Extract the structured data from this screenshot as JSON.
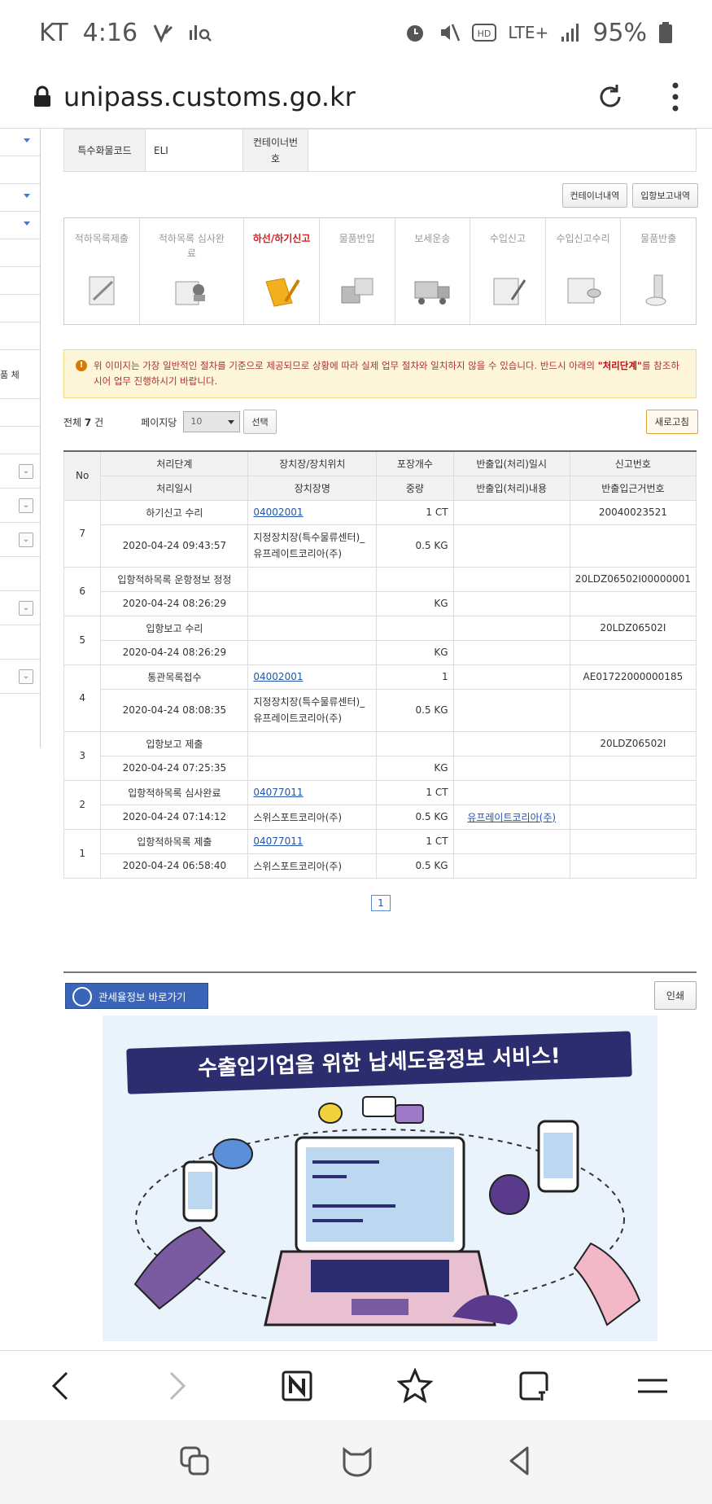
{
  "status": {
    "carrier": "KT",
    "time": "4:16",
    "battery": "95%",
    "network": "LTE+"
  },
  "browser": {
    "url": "unipass.customs.go.kr"
  },
  "sidebar": {
    "label": "품 체"
  },
  "info": {
    "special_code_label": "특수화물코드",
    "special_code_value": "ELI",
    "container_label": "컨테이너번호",
    "container_value": ""
  },
  "buttons": {
    "container_history": "컨테이너내역",
    "entry_report": "입항보고내역",
    "select": "선택",
    "refresh": "새로고침",
    "print": "인쇄"
  },
  "process_steps": [
    {
      "label": "적하목록제출"
    },
    {
      "label": "적하목록 심사완료"
    },
    {
      "label": "하선/하기신고"
    },
    {
      "label": "물품반입"
    },
    {
      "label": "보세운송"
    },
    {
      "label": "수입신고"
    },
    {
      "label": "수입신고수리"
    },
    {
      "label": "물품반출"
    }
  ],
  "notice": {
    "text1": "위 이미지는 가장 일반적인 절차를 기준으로 제공되므로 상황에 따라 실제 업무 절차와 일치하지 않을 수 있습니다. 반드시 아래의 ",
    "highlight": "\"처리단계\"",
    "text2": "를 참조하시어 업무 진행하시기 바랍니다."
  },
  "list": {
    "total_prefix": "전체",
    "total_count": "7",
    "total_suffix": "건",
    "per_page_label": "페이지당",
    "per_page_value": "10"
  },
  "table": {
    "headers1": {
      "no": "No",
      "step": "처리단계",
      "loc": "장치장/장치위치",
      "pkg": "포장개수",
      "inout_date": "반출입(처리)일시",
      "report_no": "신고번호"
    },
    "headers2": {
      "date": "처리일시",
      "loc_name": "장치장명",
      "weight": "중량",
      "inout_content": "반출입(처리)내용",
      "basis_no": "반출입근거번호"
    },
    "rows": [
      {
        "no": "7",
        "step": "하기신고 수리",
        "loc": "04002001",
        "pkg": "1 CT",
        "inout": "",
        "report": "20040023521",
        "date": "2020-04-24 09:43:57",
        "loc_name": "지정장치장(특수물류센터)_유프레이트코리아(주)",
        "weight": "0.5 KG",
        "content": "",
        "basis": ""
      },
      {
        "no": "6",
        "step": "입항적하목록 운항정보 정정",
        "loc": "",
        "pkg": "",
        "inout": "",
        "report": "20LDZ06502I00000001",
        "date": "2020-04-24 08:26:29",
        "loc_name": "",
        "weight": "KG",
        "content": "",
        "basis": ""
      },
      {
        "no": "5",
        "step": "입항보고 수리",
        "loc": "",
        "pkg": "",
        "inout": "",
        "report": "20LDZ06502I",
        "date": "2020-04-24 08:26:29",
        "loc_name": "",
        "weight": "KG",
        "content": "",
        "basis": ""
      },
      {
        "no": "4",
        "step": "통관목록접수",
        "loc": "04002001",
        "pkg": "1",
        "inout": "",
        "report": "AE01722000000185",
        "date": "2020-04-24 08:08:35",
        "loc_name": "지정장치장(특수물류센터)_유프레이트코리아(주)",
        "weight": "0.5 KG",
        "content": "",
        "basis": ""
      },
      {
        "no": "3",
        "step": "입항보고 제출",
        "loc": "",
        "pkg": "",
        "inout": "",
        "report": "20LDZ06502I",
        "date": "2020-04-24 07:25:35",
        "loc_name": "",
        "weight": "KG",
        "content": "",
        "basis": ""
      },
      {
        "no": "2",
        "step": "입항적하목록 심사완료",
        "loc": "04077011",
        "pkg": "1 CT",
        "inout": "",
        "report": "",
        "date": "2020-04-24 07:14:12",
        "loc_name": "스위스포트코리아(주)",
        "weight": "0.5 KG",
        "content": "유프레이트코리아(주)",
        "basis": ""
      },
      {
        "no": "1",
        "step": "입항적하목록 제출",
        "loc": "04077011",
        "pkg": "1 CT",
        "inout": "",
        "report": "",
        "date": "2020-04-24 06:58:40",
        "loc_name": "스위스포트코리아(주)",
        "weight": "0.5 KG",
        "content": "",
        "basis": ""
      }
    ]
  },
  "pager": {
    "current": "1"
  },
  "bottom": {
    "tariff_link": "관세율정보 바로가기",
    "banner_title": "수출입기업을 위한 납세도움정보 서비스!"
  }
}
